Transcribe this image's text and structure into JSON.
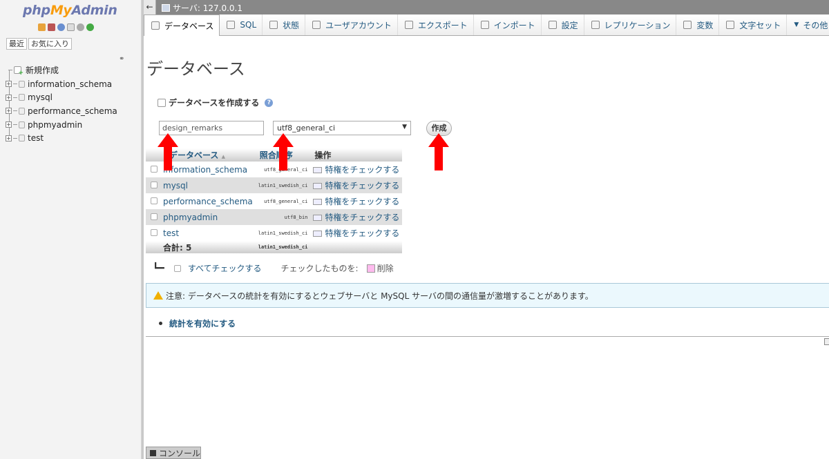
{
  "sidebar": {
    "logo_php": "php",
    "logo_my": "My",
    "logo_admin": "Admin",
    "recent_label": "最近",
    "favorites_label": "お気に入り",
    "new_label": "新規作成",
    "databases": [
      "information_schema",
      "mysql",
      "performance_schema",
      "phpmyadmin",
      "test"
    ]
  },
  "topbar": {
    "back": "←",
    "server": "サーバ: 127.0.0.1"
  },
  "tabs": [
    {
      "label": "データベース",
      "icon": "database-icon"
    },
    {
      "label": "SQL",
      "icon": "sql-icon"
    },
    {
      "label": "状態",
      "icon": "status-icon"
    },
    {
      "label": "ユーザアカウント",
      "icon": "users-icon"
    },
    {
      "label": "エクスポート",
      "icon": "export-icon"
    },
    {
      "label": "インポート",
      "icon": "import-icon"
    },
    {
      "label": "設定",
      "icon": "wrench-icon"
    },
    {
      "label": "レプリケーション",
      "icon": "replication-icon"
    },
    {
      "label": "変数",
      "icon": "variables-icon"
    },
    {
      "label": "文字セット",
      "icon": "charset-icon"
    },
    {
      "label": "その他",
      "icon": "chevron-down-icon"
    }
  ],
  "main": {
    "title": "データベース",
    "create_label": "データベースを作成する",
    "db_name_value": "design_remarks",
    "collation_value": "utf8_general_ci",
    "create_button": "作成",
    "table": {
      "headers": {
        "database": "データベース",
        "collation": "照合順序",
        "operations": "操作"
      },
      "sort_indicator": "▲",
      "rows": [
        {
          "name": "information_schema",
          "collation": "utf8_general_ci",
          "action": "特権をチェックする"
        },
        {
          "name": "mysql",
          "collation": "latin1_swedish_ci",
          "action": "特権をチェックする"
        },
        {
          "name": "performance_schema",
          "collation": "utf8_general_ci",
          "action": "特権をチェックする"
        },
        {
          "name": "phpmyadmin",
          "collation": "utf8_bin",
          "action": "特権をチェックする"
        },
        {
          "name": "test",
          "collation": "latin1_swedish_ci",
          "action": "特権をチェックする"
        }
      ],
      "total_label": "合計: 5",
      "total_collation": "latin1_swedish_ci"
    },
    "check_all": "すべてチェックする",
    "with_selected": "チェックしたものを:",
    "delete": "削除",
    "notice": "注意: データベースの統計を有効にするとウェブサーバと MySQL サーバの間の通信量が激増することがあります。",
    "enable_stats": "統計を有効にする"
  },
  "console_label": "コンソール",
  "colors": {
    "accent": "#235a81",
    "annotation": "#ff0000",
    "logo_blue": "#6c78af",
    "logo_orange": "#f89c0e"
  }
}
